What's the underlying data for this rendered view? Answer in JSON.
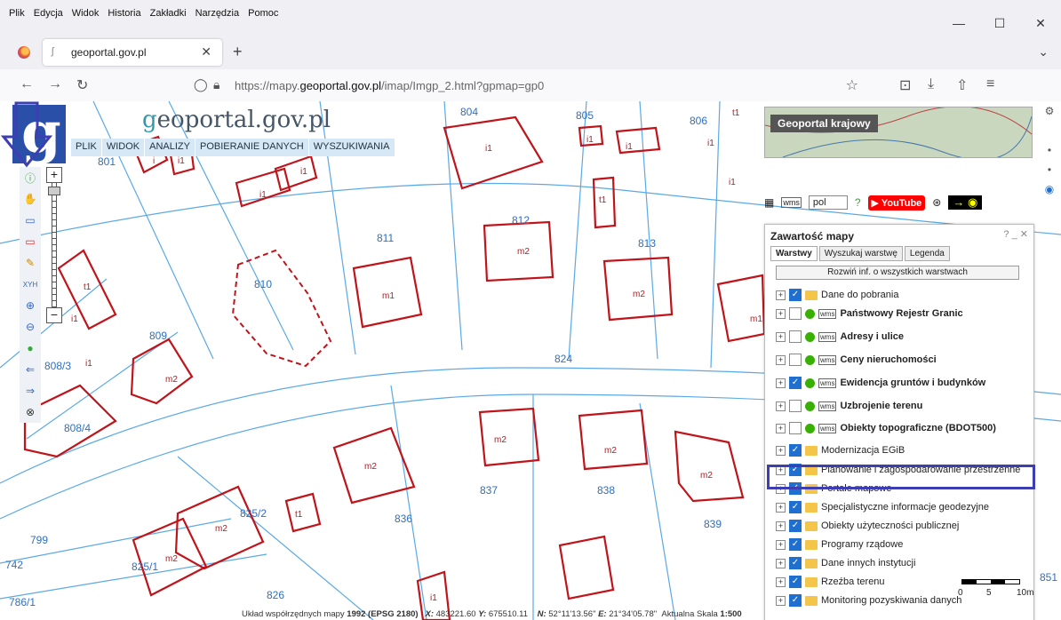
{
  "menubar": {
    "items": [
      "Plik",
      "Edycja",
      "Widok",
      "Historia",
      "Zakładki",
      "Narzędzia",
      "Pomoc"
    ],
    "min": "—",
    "max": "☐",
    "close": "✕"
  },
  "tab": {
    "title": "geoportal.gov.pl",
    "close": "✕",
    "new": "+"
  },
  "nav": {
    "back": "←",
    "forward": "→",
    "reload": "↻",
    "url_prefix": "https://mapy.",
    "url_domain": "geoportal.gov.pl",
    "url_suffix": "/imap/Imgp_2.html?gpmap=gp0",
    "star": "☆",
    "pocket": "⊡",
    "download": "⤓",
    "share": "⇧",
    "menu": "≡"
  },
  "site": {
    "title_g": "g",
    "title_rest": "eoportal.gov.pl",
    "logo_letter": "g",
    "menu": [
      "PLIK",
      "WIDOK",
      "ANALIZY",
      "POBIERANIE DANYCH",
      "WYSZUKIWANIA"
    ]
  },
  "tools": [
    "ⓘ",
    "✋",
    "▭",
    "▭",
    "✎",
    "XYH",
    "⊕",
    "⊖",
    "●",
    "⇐",
    "⇒",
    "⊗"
  ],
  "zoom": {
    "plus": "+",
    "minus": "−"
  },
  "overview": {
    "label": "Geoportal krajowy"
  },
  "topbar": {
    "lang": "pol",
    "youtube": "YouTube"
  },
  "panel": {
    "title": "Zawartość mapy",
    "controls": "? _ ✕",
    "tabs": [
      "Warstwy",
      "Wyszukaj warstwę",
      "Legenda"
    ],
    "expand": "Rozwiń inf. o wszystkich warstwach",
    "layers": [
      {
        "name": "Dane do pobrania",
        "checked": true,
        "kind": "folder",
        "bold": false
      },
      {
        "name": "Państwowy Rejestr Granic",
        "checked": false,
        "kind": "wms",
        "bold": true
      },
      {
        "name": "Adresy i ulice",
        "checked": false,
        "kind": "wms",
        "bold": true
      },
      {
        "name": "Ceny nieruchomości",
        "checked": false,
        "kind": "wms",
        "bold": true
      },
      {
        "name": "Ewidencja gruntów i budynków",
        "checked": true,
        "kind": "wms",
        "bold": true
      },
      {
        "name": "Uzbrojenie terenu",
        "checked": false,
        "kind": "wms",
        "bold": true
      },
      {
        "name": "Obiekty topograficzne (BDOT500)",
        "checked": false,
        "kind": "wms",
        "bold": true
      },
      {
        "name": "Modernizacja EGiB",
        "checked": true,
        "kind": "folder",
        "bold": false
      },
      {
        "name": "Planowanie i zagospodarowanie przestrzenne",
        "checked": true,
        "kind": "folder",
        "bold": false
      },
      {
        "name": "Portale mapowe",
        "checked": true,
        "kind": "folder",
        "bold": false
      },
      {
        "name": "Specjalistyczne informacje geodezyjne",
        "checked": true,
        "kind": "folder",
        "bold": false
      },
      {
        "name": "Obiekty użyteczności publicznej",
        "checked": true,
        "kind": "folder",
        "bold": false
      },
      {
        "name": "Programy rządowe",
        "checked": true,
        "kind": "folder",
        "bold": false
      },
      {
        "name": "Dane innych instytucji",
        "checked": true,
        "kind": "folder",
        "bold": false
      },
      {
        "name": "Rzeźba terenu",
        "checked": true,
        "kind": "folder",
        "bold": false
      },
      {
        "name": "Monitoring pozyskiwania danych",
        "checked": true,
        "kind": "folder",
        "bold": false
      }
    ]
  },
  "parcels": {
    "blue_labels": [
      "801",
      "804",
      "805",
      "806",
      "809",
      "810",
      "811",
      "812",
      "813",
      "808/4",
      "824",
      "799",
      "742",
      "825/1",
      "825/2",
      "826",
      "836",
      "837",
      "838",
      "839",
      "786/1",
      "808/3",
      "851"
    ],
    "red_labels": [
      "m2",
      "i1",
      "i1",
      "i1",
      "i1",
      "i1",
      "t1",
      "i1",
      "i1",
      "i1",
      "t1",
      "i",
      "t1",
      "m1",
      "m2",
      "m2",
      "m1",
      "m2",
      "m2",
      "m2",
      "m2",
      "m2",
      "m2",
      "m2",
      "t1",
      "m2",
      "i1",
      "i1",
      "i1"
    ]
  },
  "scale": {
    "ticks": [
      "0",
      "5",
      "10m"
    ]
  },
  "status": {
    "prefix": "Układ współrzędnych mapy ",
    "crs": "1992 (EPSG 2180)",
    "x_label": "X:",
    "x": "483221.60",
    "y_label": "Y:",
    "y": "675510.11",
    "n_label": "N:",
    "n": "52°11'13.56\"",
    "e_label": "E:",
    "e": "21°34'05.78\"",
    "scale_label": "Aktualna Skala ",
    "scale": "1:500"
  },
  "colors": {
    "parcel_line": "#5aa9e6",
    "building": "#c0141b",
    "highlight": "#3e3eb3",
    "menu_bg": "#d6e8f5"
  }
}
